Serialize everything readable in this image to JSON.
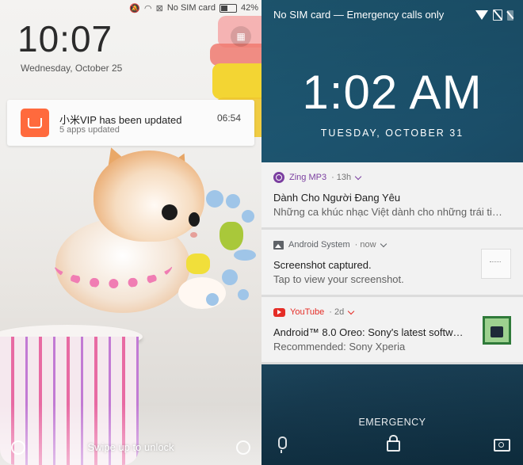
{
  "left_phone": {
    "status": {
      "signal": "No SIM card",
      "battery": "42%",
      "battery_level": 0.42
    },
    "time": "10:07",
    "date": "Wednesday, October 25",
    "notification": {
      "title": "小米VIP has been updated",
      "subtitle": "5 apps updated",
      "time": "06:54"
    },
    "unlock_hint": "Swipe up to unlock"
  },
  "right_phone": {
    "status": {
      "text": "No SIM card — Emergency calls only"
    },
    "time": "1:02 AM",
    "date": "TUESDAY, OCTOBER 31",
    "notifications": [
      {
        "app": "Zing MP3",
        "meta": "· 13h",
        "app_color": "#7b3fa0",
        "title": "Dành Cho Người Đang Yêu",
        "text": "Những ca khúc nhạc Việt dành cho những trái tim đ..."
      },
      {
        "app": "Android System",
        "meta": "· now",
        "app_color": "#5f6368",
        "title": "Screenshot captured.",
        "text": "Tap to view your screenshot."
      },
      {
        "app": "YouTube",
        "meta": "· 2d",
        "app_color": "#e52d27",
        "title": "Android™ 8.0 Oreo: Sony's latest software..",
        "text": "Recommended: Sony Xperia"
      }
    ],
    "emergency": "EMERGENCY"
  }
}
